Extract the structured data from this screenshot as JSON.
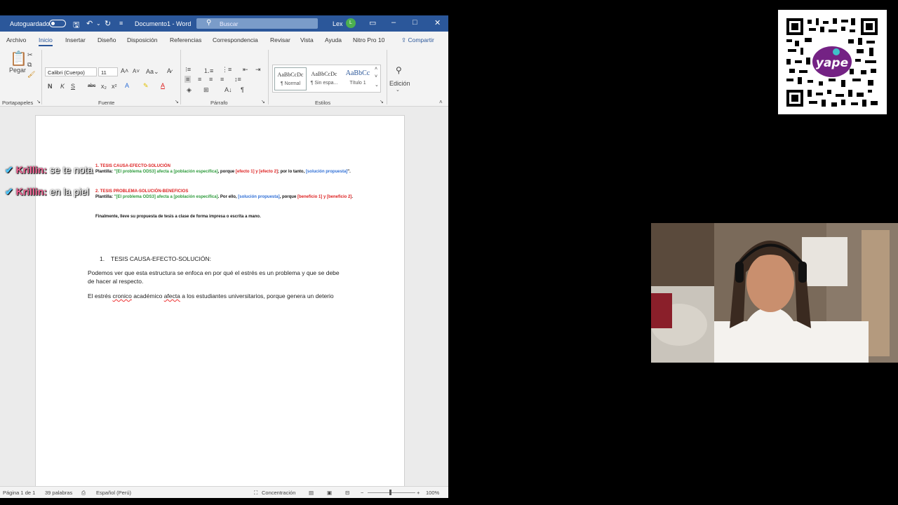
{
  "titlebar": {
    "autosave_label": "Autoguardado",
    "doc_title": "Documento1 - Word",
    "search_placeholder": "Buscar",
    "user_name": "Lex",
    "user_initial": "L"
  },
  "tabs": [
    "Archivo",
    "Inicio",
    "Insertar",
    "Diseño",
    "Disposición",
    "Referencias",
    "Correspondencia",
    "Revisar",
    "Vista",
    "Ayuda",
    "Nitro Pro 10"
  ],
  "active_tab": "Inicio",
  "share_label": "Compartir",
  "ribbon": {
    "paste_label": "Pegar",
    "clipboard_group": "Portapapeles",
    "font_name": "Calibri (Cuerpo)",
    "font_size": "11",
    "font_group": "Fuente",
    "paragraph_group": "Párrafo",
    "styles_group": "Estilos",
    "styles": [
      {
        "preview": "AaBbCcDc",
        "name": "¶ Normal"
      },
      {
        "preview": "AaBbCcDc",
        "name": "¶ Sin espa..."
      },
      {
        "preview": "AaBbCc",
        "name": "Título 1"
      }
    ],
    "edit_label": "Edición",
    "bold": "N",
    "italic": "K",
    "underline": "S",
    "strike": "abc",
    "sub": "x₂",
    "sup": "x²"
  },
  "document": {
    "h1": "1. TESIS CAUSA-EFECTO-SOLUCIÓN",
    "t1_label": "Plantilla:",
    "t1_a": "\"[El problema ODS3] afecta a [población específica]",
    "t1_b": ", porque",
    "t1_c": "[efecto 1] y [efecto 2]",
    "t1_d": "; por lo tanto,",
    "t1_e": "[solución propuesta]",
    "t1_f": "\".",
    "h2": "2. TESIS PROBLEMA-SOLUCIÓN-BENEFICIOS",
    "t2_label": "Plantilla:",
    "t2_a": "\"[El problema ODS3] afecta a [población específica]",
    "t2_b": ". Por ello,",
    "t2_c": "[solución propuesta]",
    "t2_d": ", porque",
    "t2_e": "[beneficio 1] y [beneficio 2]",
    "t2_f": ".",
    "final_note": "Finalmente, lleve su propuesta de tesis a clase de forma impresa o escrita a mano.",
    "list_item_num": "1.",
    "list_item": "TESIS CAUSA-EFECTO-SOLUCIÓN:",
    "para1_line1": "Podemos ver que esta estructura se enfoca en por qué el estrés es un problema y que se debe",
    "para1_line2": "de hacer al respecto.",
    "para2_a": "El estrés ",
    "para2_b": "cronico",
    "para2_c": " académico ",
    "para2_d": "afecta",
    "para2_e": " a los estudiantes universitarios, porque genera un deterio"
  },
  "status": {
    "page": "Página 1 de 1",
    "words": "39 palabras",
    "language": "Español (Perú)",
    "focus": "Concentración",
    "zoom": "100%"
  },
  "chat": [
    {
      "user": "Krillin:",
      "message": "se te nota"
    },
    {
      "user": "Krillin:",
      "message": "en la piel"
    }
  ],
  "qr_brand": "yape",
  "colors": {
    "word_blue": "#2b579a",
    "template_red": "#d22",
    "template_green": "#2c9a3a",
    "template_blue": "#2f6fd6",
    "yape_purple": "#742284"
  }
}
